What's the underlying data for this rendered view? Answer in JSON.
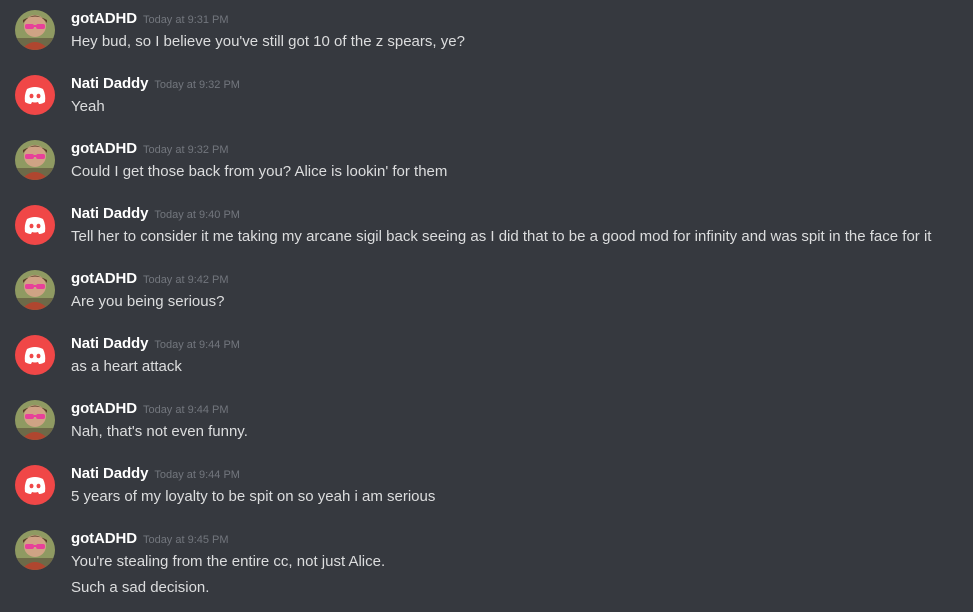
{
  "colors": {
    "background": "#36393f",
    "username": "#ffffff",
    "timestamp": "#72767d",
    "text": "#dcddde",
    "discord_avatar": "#f04747"
  },
  "messages": [
    {
      "author": "gotADHD",
      "avatar": "user-avatar-photo",
      "timestamp": "Today at 9:31 PM",
      "lines": [
        "Hey bud, so I believe you've still got 10 of the z spears, ye?"
      ]
    },
    {
      "author": "Nati Daddy",
      "avatar": "discord-logo-icon",
      "timestamp": "Today at 9:32 PM",
      "lines": [
        "Yeah"
      ]
    },
    {
      "author": "gotADHD",
      "avatar": "user-avatar-photo",
      "timestamp": "Today at 9:32 PM",
      "lines": [
        "Could I get those back from you? Alice is lookin' for them"
      ]
    },
    {
      "author": "Nati Daddy",
      "avatar": "discord-logo-icon",
      "timestamp": "Today at 9:40 PM",
      "lines": [
        "Tell her to consider it me taking my arcane sigil back seeing as I did that to be a good mod for infinity and was spit in the face for it"
      ]
    },
    {
      "author": "gotADHD",
      "avatar": "user-avatar-photo",
      "timestamp": "Today at 9:42 PM",
      "lines": [
        "Are you being serious?"
      ]
    },
    {
      "author": "Nati Daddy",
      "avatar": "discord-logo-icon",
      "timestamp": "Today at 9:44 PM",
      "lines": [
        "as a heart attack"
      ]
    },
    {
      "author": "gotADHD",
      "avatar": "user-avatar-photo",
      "timestamp": "Today at 9:44 PM",
      "lines": [
        "Nah, that's not even funny."
      ]
    },
    {
      "author": "Nati Daddy",
      "avatar": "discord-logo-icon",
      "timestamp": "Today at 9:44 PM",
      "lines": [
        "5 years of my loyalty to be spit on so yeah i am serious"
      ]
    },
    {
      "author": "gotADHD",
      "avatar": "user-avatar-photo",
      "timestamp": "Today at 9:45 PM",
      "lines": [
        "You're stealing from the entire cc, not just Alice.",
        "Such a sad decision."
      ]
    }
  ]
}
